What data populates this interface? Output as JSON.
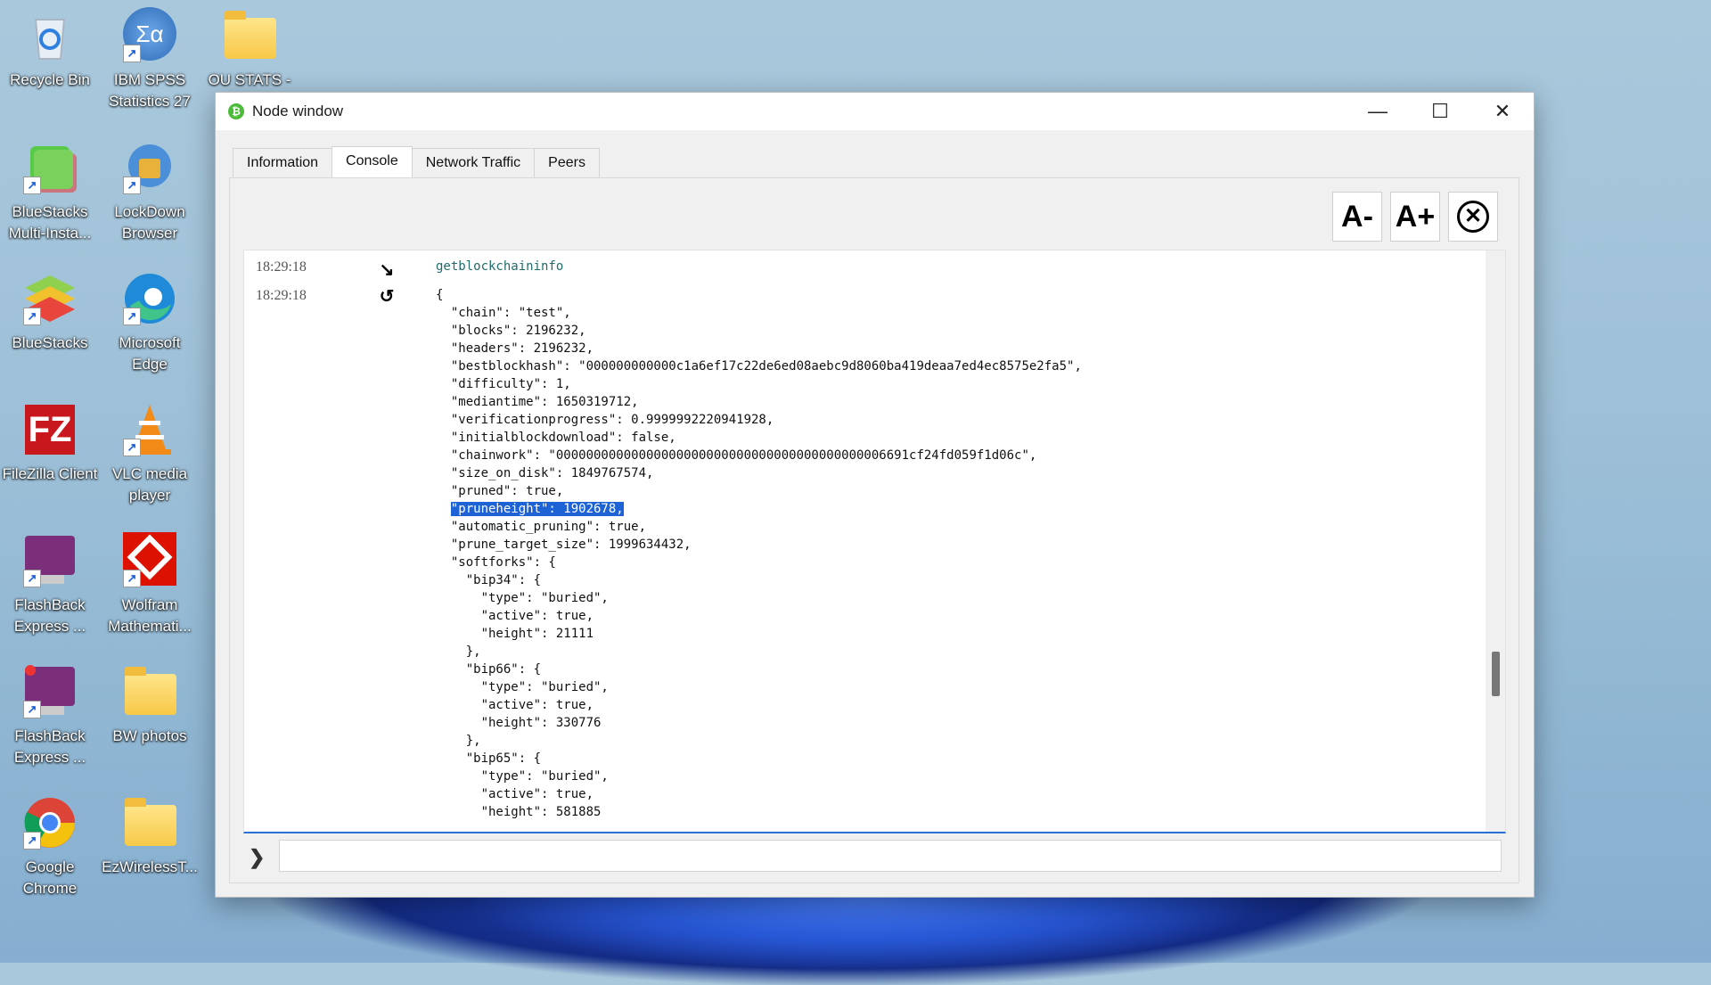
{
  "desktop": {
    "icons": [
      {
        "label": "Recycle Bin"
      },
      {
        "label": "IBM SPSS Statistics 27"
      },
      {
        "label": "OU STATS -"
      },
      {
        "label": "BlueStacks Multi-Insta..."
      },
      {
        "label": "LockDown Browser"
      },
      {
        "label": "BlueStacks"
      },
      {
        "label": "Microsoft Edge"
      },
      {
        "label": "FileZilla Client"
      },
      {
        "label": "VLC media player"
      },
      {
        "label": "FlashBack Express ..."
      },
      {
        "label": "Wolfram Mathemati..."
      },
      {
        "label": "FlashBack Express ..."
      },
      {
        "label": "BW photos"
      },
      {
        "label": "Google Chrome"
      },
      {
        "label": "EzWirelessT..."
      }
    ]
  },
  "window": {
    "title": "Node window",
    "controls": {
      "minimize": "—",
      "maximize": "☐",
      "close": "✕"
    }
  },
  "tabs": [
    {
      "label": "Information",
      "active": false
    },
    {
      "label": "Console",
      "active": true
    },
    {
      "label": "Network Traffic",
      "active": false
    },
    {
      "label": "Peers",
      "active": false
    }
  ],
  "toolbar": {
    "font_smaller": "A-",
    "font_larger": "A+",
    "clear": "✕"
  },
  "console": {
    "entries": [
      {
        "time": "18:29:18",
        "direction": "input",
        "text": "getblockchaininfo"
      },
      {
        "time": "18:29:18",
        "direction": "output"
      }
    ],
    "output_before_highlight": "{\n  \"chain\": \"test\",\n  \"blocks\": 2196232,\n  \"headers\": 2196232,\n  \"bestblockhash\": \"000000000000c1a6ef17c22de6ed08aebc9d8060ba419deaa7ed4ec8575e2fa5\",\n  \"difficulty\": 1,\n  \"mediantime\": 1650319712,\n  \"verificationprogress\": 0.9999992220941928,\n  \"initialblockdownload\": false,\n  \"chainwork\": \"00000000000000000000000000000000000000000006691cf24fd059f1d06c\",\n  \"size_on_disk\": 1849767574,\n  \"pruned\": true,\n  ",
    "output_highlight": "\"pruneheight\": 1902678,",
    "output_after_highlight": "\n  \"automatic_pruning\": true,\n  \"prune_target_size\": 1999634432,\n  \"softforks\": {\n    \"bip34\": {\n      \"type\": \"buried\",\n      \"active\": true,\n      \"height\": 21111\n    },\n    \"bip66\": {\n      \"type\": \"buried\",\n      \"active\": true,\n      \"height\": 330776\n    },\n    \"bip65\": {\n      \"type\": \"buried\",\n      \"active\": true,\n      \"height\": 581885",
    "input_value": "",
    "prompt": "❯"
  }
}
